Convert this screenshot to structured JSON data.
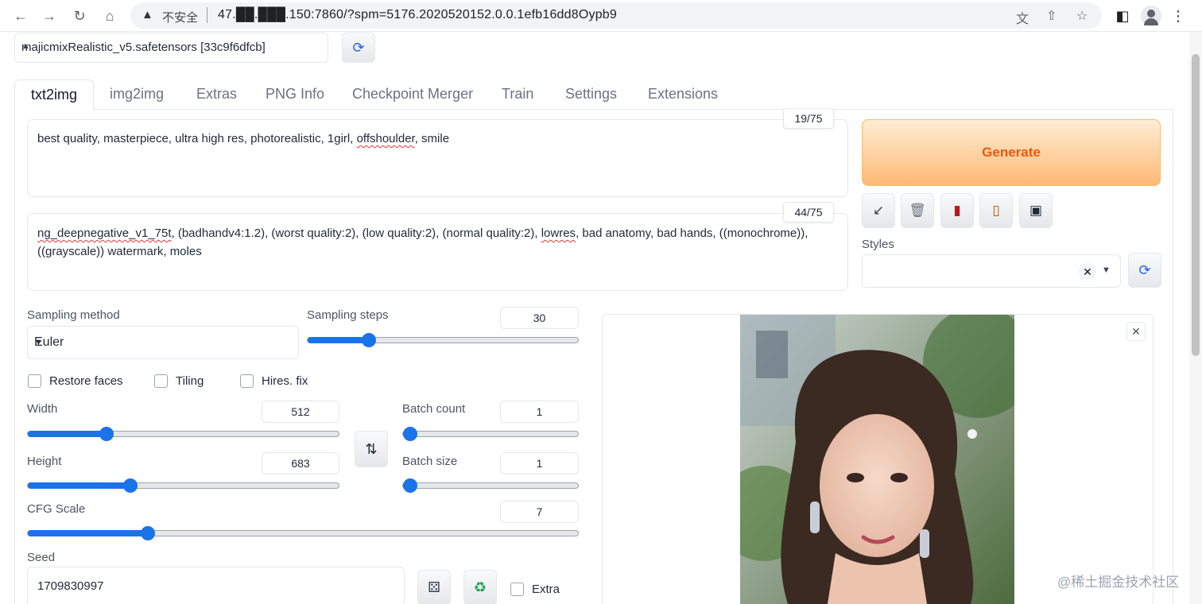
{
  "browser": {
    "security_label": "不安全",
    "url": "47.██.███.150:7860/?spm=5176.2020520152.0.0.1efb16dd8Oypb9"
  },
  "checkpoint": {
    "value": "majicmixRealistic_v5.safetensors [33c9f6dfcb]"
  },
  "tabs": [
    {
      "label": "txt2img",
      "active": true
    },
    {
      "label": "img2img"
    },
    {
      "label": "Extras"
    },
    {
      "label": "PNG Info"
    },
    {
      "label": "Checkpoint Merger"
    },
    {
      "label": "Train"
    },
    {
      "label": "Settings"
    },
    {
      "label": "Extensions"
    }
  ],
  "prompt": {
    "text_part1": "best quality, masterpiece, ultra high res, photorealistic, 1girl, ",
    "text_flagged": "offshoulder",
    "text_part2": ", smile",
    "counter": "19/75"
  },
  "negative_prompt": {
    "flagged1": "ng_deepnegative_v1_75t",
    "part1": ", (badhandv4:1.2), (worst quality:2), (low quality:2), (normal quality:2), ",
    "flagged2": "lowres",
    "part2": ", bad anatomy, bad hands, ((monochrome)), ((grayscale)) watermark, moles",
    "counter": "44/75"
  },
  "generate_label": "Generate",
  "styles": {
    "label": "Styles",
    "clear_symbol": "✕"
  },
  "sampling": {
    "method_label": "Sampling method",
    "method_value": "Euler",
    "steps_label": "Sampling steps",
    "steps_value": "30",
    "steps_fraction": 0.21
  },
  "options": {
    "restore_faces": "Restore faces",
    "tiling": "Tiling",
    "hires_fix": "Hires. fix"
  },
  "size": {
    "width_label": "Width",
    "width_value": "512",
    "width_fraction": 0.24,
    "height_label": "Height",
    "height_value": "683",
    "height_fraction": 0.32
  },
  "batch": {
    "count_label": "Batch count",
    "count_value": "1",
    "count_fraction": 0.0,
    "size_label": "Batch size",
    "size_value": "1",
    "size_fraction": 0.0
  },
  "cfg": {
    "label": "CFG Scale",
    "value": "7",
    "fraction": 0.21
  },
  "seed": {
    "label": "Seed",
    "value": "1709830997",
    "extra_label": "Extra"
  },
  "gallery": {
    "close_symbol": "✕"
  },
  "watermark": "@稀土掘金技术社区",
  "colors": {
    "accent": "#1a73e8",
    "generate_text": "#ea580c"
  }
}
